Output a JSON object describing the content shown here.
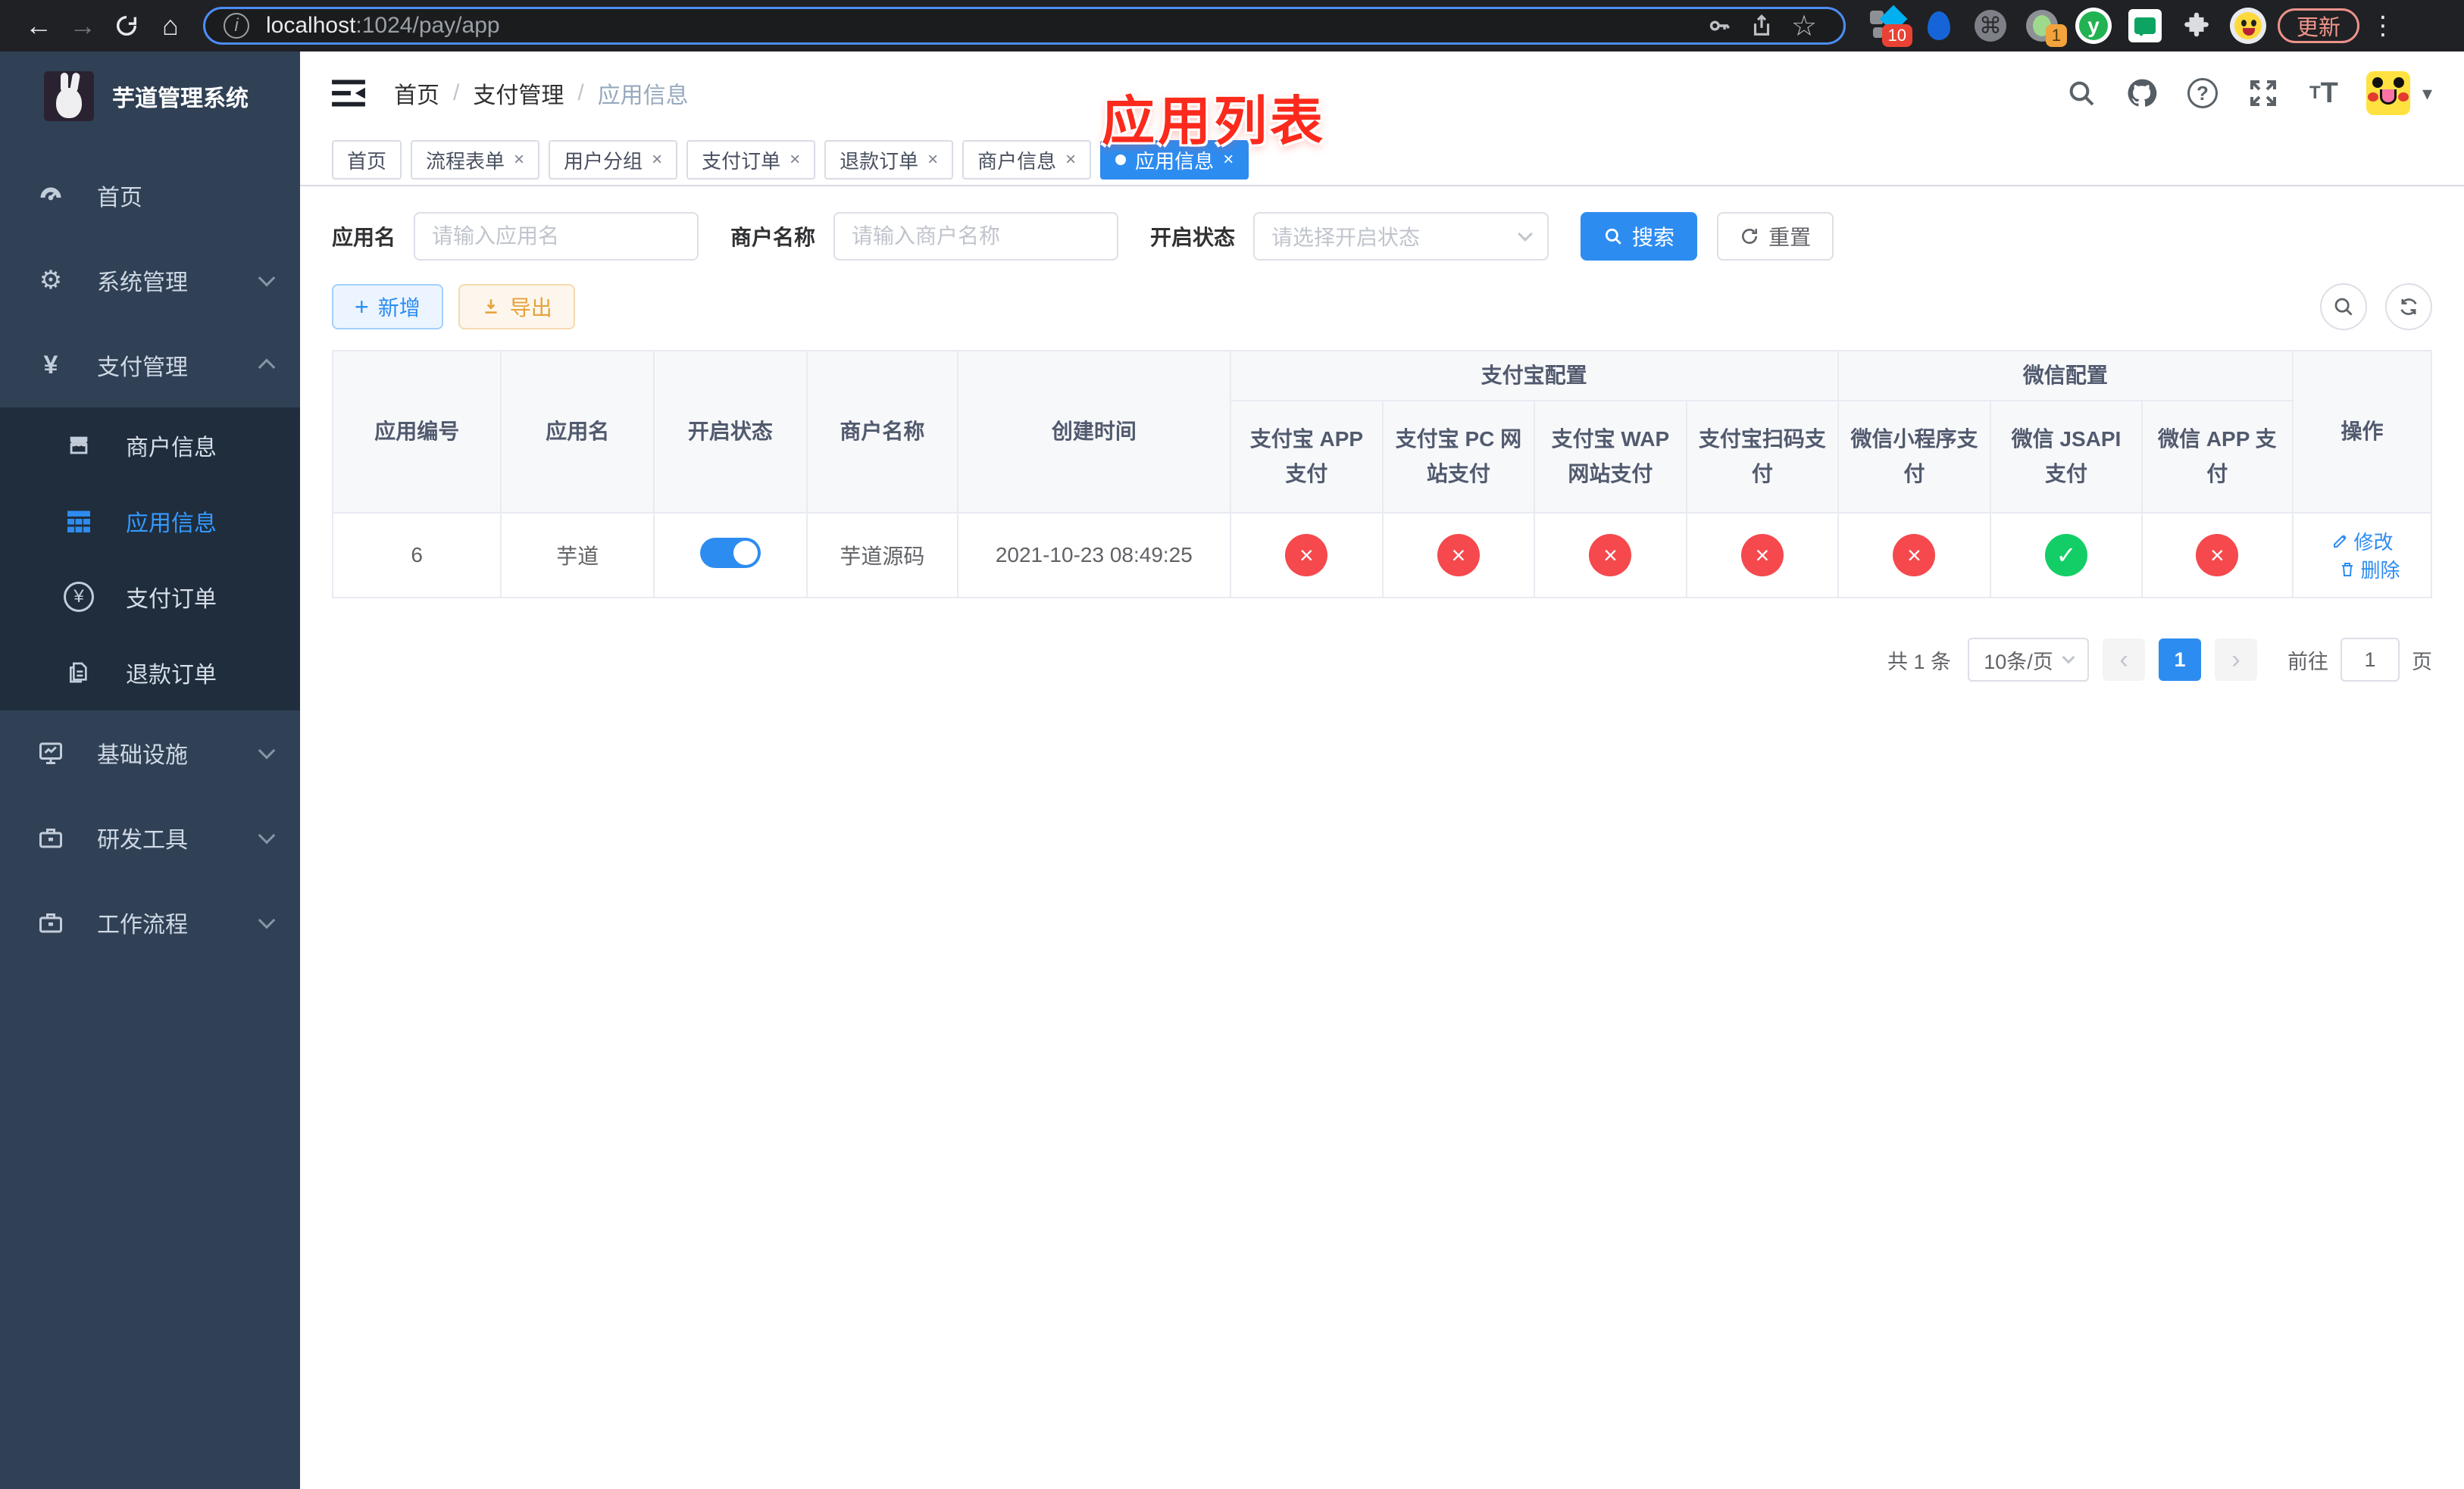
{
  "browser": {
    "url_host": "localhost",
    "url_rest": ":1024/pay/app",
    "update_button": "更新",
    "ext_badge_count": "10",
    "ext_badge_count2": "1"
  },
  "icons": {
    "back": "←",
    "forward": "→",
    "home": "⌂",
    "info": "i",
    "command": "⌘",
    "star": "☆",
    "more": "⋮",
    "caret_down": "▾",
    "check": "✓",
    "cross": "×",
    "close": "×",
    "plus": "+",
    "prev": "‹",
    "next": "›",
    "gear": "⚙",
    "yen": "¥",
    "question": "?",
    "y_ext": "y",
    "font_small": "T",
    "font_large": "T"
  },
  "sidebar": {
    "title": "芋道管理系统",
    "menu": [
      {
        "label": "首页"
      },
      {
        "label": "系统管理"
      },
      {
        "label": "支付管理"
      },
      {
        "label": "基础设施"
      },
      {
        "label": "研发工具"
      },
      {
        "label": "工作流程"
      }
    ],
    "submenu": [
      {
        "label": "商户信息"
      },
      {
        "label": "应用信息"
      },
      {
        "label": "支付订单"
      },
      {
        "label": "退款订单"
      }
    ]
  },
  "navbar": {
    "breadcrumb": [
      "首页",
      "支付管理",
      "应用信息"
    ],
    "separator": "/"
  },
  "annotation": "应用列表",
  "tabs": [
    {
      "label": "首页"
    },
    {
      "label": "流程表单"
    },
    {
      "label": "用户分组"
    },
    {
      "label": "支付订单"
    },
    {
      "label": "退款订单"
    },
    {
      "label": "商户信息"
    },
    {
      "label": "应用信息"
    }
  ],
  "filters": {
    "app_name_label": "应用名",
    "app_name_placeholder": "请输入应用名",
    "merchant_label": "商户名称",
    "merchant_placeholder": "请输入商户名称",
    "status_label": "开启状态",
    "status_placeholder": "请选择开启状态",
    "search_button": "搜索",
    "reset_button": "重置"
  },
  "toolbar": {
    "add": "新增",
    "export": "导出"
  },
  "table": {
    "groups": {
      "alipay": "支付宝配置",
      "wechat": "微信配置"
    },
    "columns": {
      "id": "应用编号",
      "name": "应用名",
      "status": "开启状态",
      "merchant": "商户名称",
      "created": "创建时间",
      "alipay_app": "支付宝 APP 支付",
      "alipay_pc": "支付宝 PC 网站支付",
      "alipay_wap": "支付宝 WAP 网站支付",
      "alipay_qr": "支付宝扫码支付",
      "wx_mini": "微信小程序支付",
      "wx_jsapi": "微信 JSAPI 支付",
      "wx_app": "微信 APP 支付",
      "actions": "操作"
    },
    "row": {
      "id": "6",
      "name": "芋道",
      "enabled": true,
      "merchant": "芋道源码",
      "created": "2021-10-23 08:49:25",
      "statuses": [
        false,
        false,
        false,
        false,
        false,
        true,
        false
      ],
      "edit": "修改",
      "delete": "删除"
    }
  },
  "pagination": {
    "total": "共 1 条",
    "page_size": "10条/页",
    "current_page": "1",
    "goto_label": "前往",
    "goto_value": "1",
    "goto_unit": "页"
  },
  "colors": {
    "primary": "#2d8cf0",
    "success": "#13ce66",
    "danger": "#f5494d",
    "warning": "#e6a23c",
    "sidebar_bg": "#304156",
    "submenu_bg": "#1f2d3d"
  }
}
